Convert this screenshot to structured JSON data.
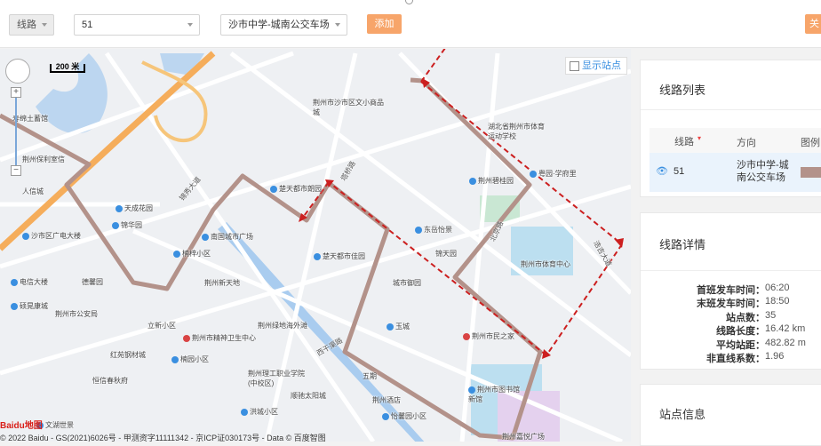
{
  "toolbar": {
    "type_select": "线路",
    "line_select": "51",
    "direction_select": "沙市中学-城南公交车场",
    "add_label": "添加",
    "close_label": "关"
  },
  "map": {
    "scale_label": "200 米",
    "show_stops_label": "显示站点",
    "copyright": "© 2022 Baidu - GS(2021)6026号 - 甲测资字11111342 - 京ICP证030173号 - Data © 百度智图",
    "logo": "Baidu地图",
    "labels": {
      "l01": "寿绵土蓄馆",
      "l02": "荆州保利室信",
      "l03": "人信城",
      "l04": "天成花园",
      "l05": "锦华园",
      "l06": "沙市区广电大楼",
      "l07": "电信大楼",
      "l08": "德馨园",
      "l09": "硕晃康城",
      "l10": "荆州市公安局",
      "l11": "立新小区",
      "l12": "荆州市精神卫生中心",
      "l13": "红苑钢材城",
      "l14": "楠园小区",
      "l15": "恒信春秋府",
      "l16": "文湖世景",
      "l17": "荆州市沙市区文小商品城",
      "l18": "楚天都市朗园",
      "l19": "南国城市广场",
      "l20": "楠梓小区",
      "l21": "荆州新天地",
      "l22": "楚天都市佳园",
      "l23": "东岳怡景",
      "l24": "城市御园",
      "l25": "荆州碧桂园",
      "l26": "湖北省荆州市体育运动学校",
      "l27": "粤园·学府里",
      "l28": "荆州市体育中心",
      "l29": "荆州绿地海外滩",
      "l30": "玉城",
      "l31": "荆州市民之家",
      "l32": "荆州理工职业学院(中校区)",
      "l33": "五期",
      "l34": "荆州酒店",
      "l35": "怡馨园小区",
      "l36": "洪城小区",
      "l37": "顺驰太阳城",
      "l38": "荆州市图书馆新馆",
      "l39": "荆州嘉悦广场",
      "l40": "锦秀大道",
      "l41": "塔桥路",
      "l42": "北京路",
      "l43": "西干渠路",
      "l44": "浩吉大道",
      "l45": "锦天园"
    }
  },
  "route_list": {
    "title": "线路列表",
    "headers": [
      "线路",
      "方向",
      "图例"
    ],
    "row": {
      "line": "51",
      "direction": "沙市中学-城南公交车场"
    }
  },
  "route_detail": {
    "title": "线路详情",
    "rows": [
      {
        "key": "首班发车时间：",
        "value": "06:20"
      },
      {
        "key": "末班发车时间：",
        "value": "18:50"
      },
      {
        "key": "站点数：",
        "value": "35"
      },
      {
        "key": "线路长度：",
        "value": "16.42 km"
      },
      {
        "key": "平均站距：",
        "value": "482.82 m"
      },
      {
        "key": "非直线系数：",
        "value": "1.96"
      }
    ]
  },
  "stop_info": {
    "title": "站点信息"
  },
  "colors": {
    "route": "#b3928a",
    "arrow": "#cc1f1f",
    "accent": "#f7a56a",
    "road_orange": "#f5ad5b"
  }
}
